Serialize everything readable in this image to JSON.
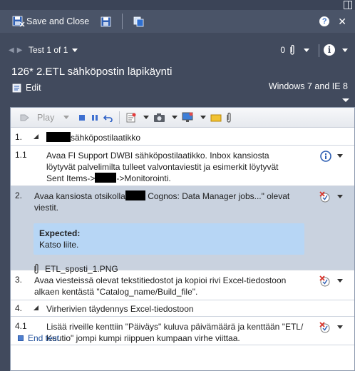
{
  "window": {
    "restore_icon": "window-restore-icon"
  },
  "commandbar": {
    "save_close_label": "Save and Close",
    "save_icon": "floppy-disk-icon",
    "clipboard_icon": "copy-icon",
    "help_glyph": "?",
    "close_glyph": "✕"
  },
  "nav": {
    "label": "Test 1 of 1",
    "attachment_count": "0",
    "info_glyph": "i"
  },
  "test_case": {
    "title": "126* 2.ETL sähköpostin läpikäynti",
    "edit_label": "Edit",
    "configuration": "Windows 7 and IE 8"
  },
  "toolbar": {
    "play_label": "Play"
  },
  "steps": [
    {
      "num": "1.",
      "text_after": "sähköpostilaatikko",
      "type": "group"
    },
    {
      "num": "1.1",
      "text_1": "Avaa FI Support DWBI sähköpostilaatikko. Inbox kansiosta löytyvät palvelimilta tulleet valvontaviestit ja esimerkit löytyvät Sent Items->",
      "text_2": "->Monitorointi.",
      "status": "info"
    },
    {
      "num": "2.",
      "text_1": "Avaa kansiosta otsikolla",
      "text_2": " Cognos: Data Manager jobs...\" olevat viestit.",
      "status": "fail",
      "expected_title": "Expected:",
      "expected_text": "Katso liite.",
      "attachment": "ETL_sposti_1.PNG"
    },
    {
      "num": "3.",
      "text": "Avaa viesteissä olevat tekstitiedostot ja kopioi rivi Excel-tiedostoon alkaen kentästä \"Catalog_name/Build_file\".",
      "status": "fail"
    },
    {
      "num": "4.",
      "text": "Virherivien täydennys Excel-tiedostoon",
      "type": "group"
    },
    {
      "num": "4.1",
      "text": "Lisää riveille kenttiin \"Päiväys\" kuluva päivämäärä ja kenttään \"ETL/ Kuutio\" jompi kumpi riippuen kumpaan virhe viittaa.",
      "status": "fail"
    }
  ],
  "end_test_label": "End test",
  "colors": {
    "header_bg": "#414a5d",
    "selected_row": "#c9d2df",
    "expected_bg": "#b7d6f5",
    "link": "#1f4f9b"
  }
}
